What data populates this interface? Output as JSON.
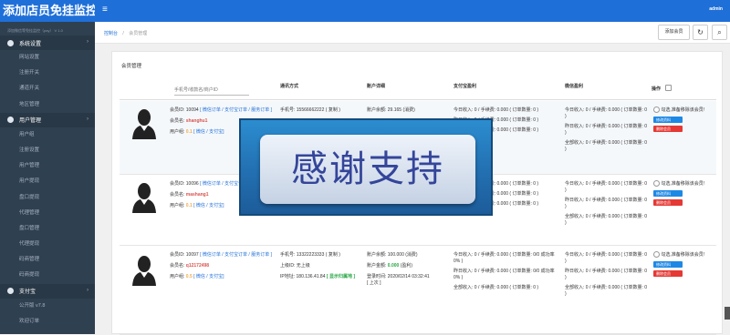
{
  "app": {
    "logo": "添加店员免挂监控",
    "subtitle": "添加微信等免挂监控（pay） V 1.0",
    "user": "admin"
  },
  "sidebar": [
    {
      "type": "section",
      "label": "系统设置",
      "icon": "gear-icon"
    },
    {
      "type": "item",
      "label": "网站设置"
    },
    {
      "type": "item",
      "label": "注册开关"
    },
    {
      "type": "item",
      "label": "通道开关"
    },
    {
      "type": "item",
      "label": "地区管理"
    },
    {
      "type": "section",
      "label": "用户管理",
      "icon": "user-icon"
    },
    {
      "type": "item",
      "label": "用户组"
    },
    {
      "type": "item",
      "label": "注册设置"
    },
    {
      "type": "item",
      "label": "用户管理"
    },
    {
      "type": "item",
      "label": "用户提现"
    },
    {
      "type": "item",
      "label": "盘口提现"
    },
    {
      "type": "item",
      "label": "代理管理"
    },
    {
      "type": "item",
      "label": "盘口管理"
    },
    {
      "type": "item",
      "label": "代理提现"
    },
    {
      "type": "item",
      "label": "码商管理"
    },
    {
      "type": "item",
      "label": "码商提现"
    },
    {
      "type": "section",
      "label": "支付宝",
      "icon": "alipay-icon"
    },
    {
      "type": "item",
      "label": "公开版 v7.8"
    },
    {
      "type": "item",
      "label": "欢迎订单"
    }
  ],
  "breadcrumb": {
    "home": "控制台",
    "sep": "/",
    "current": "会员管理"
  },
  "toolbar": {
    "add_label": "添加会员",
    "refresh_icon": "↻",
    "search_icon": "⌕"
  },
  "panel": {
    "title": "会员管理",
    "search_placeholder": "手机号/收款名/商户ID",
    "headers": {
      "contact": "通讯方式",
      "account": "账户详细",
      "alipay": "支付宝盈利",
      "wechat": "微信盈利",
      "ops": "操作"
    }
  },
  "rows": [
    {
      "id_label": "会员ID:",
      "id": "10094",
      "id_links": "[ 微信订单 / 支付宝订单 / 服务订单 ]",
      "name_label": "会员名:",
      "name": "shanghu1",
      "group_label": "用户组:",
      "group": "0.1",
      "group_links": "[ 微信 / 支付宝]",
      "phone_label": "手机号:",
      "phone": "15566662222",
      "copy": "( 复制 )",
      "balance_label": "账户余额:",
      "balance": "29.165",
      "balance_note": "(消费)",
      "ali_today": "今日收入: 0 / 手续费: 0.000 ( 订单数量: 0 )",
      "ali_yday": "昨日收入: 0 / 手续费: 0.000 ( 订单数量: 0 )",
      "ali_total": "全部收入: 0 / 手续费: 0.000 ( 订单数量: 0 )",
      "wx_today": "今日收入: 0 / 手续费: 0.000 ( 订单数量: 0 )",
      "wx_yday": "昨日收入: 0 / 手续费: 0.000 ( 订单数量: 0 )",
      "wx_total": "全部收入: 0 / 手续费: 0.000 ( 订单数量: 0 )",
      "check_text": "勾选,准备移除该会员!",
      "btn_edit": "修改资料",
      "btn_delete": "删除会员"
    },
    {
      "id_label": "会员ID:",
      "id": "10096",
      "id_links": "[ 微信订单 / 支付宝订单 / 服务订单 ]",
      "name_label": "会员名:",
      "name": "mashang1",
      "group_label": "用户组:",
      "group": "0.1",
      "group_links": "[ 微信 / 支付宝]",
      "phone_label": "手机号:",
      "phone": "",
      "copy": "",
      "balance_label": "账户余额:",
      "balance": "",
      "balance_note": "",
      "ali_today": "今日收入: 0 / 手续费: 0.000 ( 订单数量: 0 )",
      "ali_yday": "昨日收入: 0 / 手续费: 0.000 ( 订单数量: 0 )",
      "ali_total": "全部收入: 0 / 手续费: 0.000 ( 订单数量: 0 )",
      "wx_today": "今日收入: 0 / 手续费: 0.000 ( 订单数量: 0 )",
      "wx_yday": "昨日收入: 0 / 手续费: 0.000 ( 订单数量: 0 )",
      "wx_total": "全部收入: 0 / 手续费: 0.000 ( 订单数量: 0 )",
      "check_text": "勾选,准备移除该会员!",
      "btn_edit": "修改资料",
      "btn_delete": "删除会员"
    },
    {
      "id_label": "会员ID:",
      "id": "10097",
      "id_links": "[ 微信订单 / 支付宝订单 / 服务订单 ]",
      "name_label": "会员名:",
      "name": "q12172498",
      "group_label": "用户组:",
      "group": "0.5",
      "group_links": "[ 微信 / 支付宝]",
      "phone_label": "手机号:",
      "phone": "13322223333",
      "copy": "( 复制 )",
      "superior_label": "上级ID:",
      "superior": "无上级",
      "ip_label": "IP地址:",
      "ip": "180.136.41.84",
      "ip_link": "[ 显示归属地 ]",
      "balance_label": "账户余额:",
      "balance": "100.000",
      "balance_note": "(消费)",
      "deposit_label": "账户金额:",
      "deposit": "0.000",
      "deposit_note": "(盈利)",
      "login_label": "登录时间:",
      "login": "2020/02/14 03:32:41",
      "login_note": "[ 上次 ]",
      "ali_today": "今日收入: 0 / 手续费: 0.000 ( 订单数量: 0/0 成功率 0% )",
      "ali_yday": "昨日收入: 0 / 手续费: 0.000 ( 订单数量: 0/0 成功率 0% )",
      "ali_total": "全部收入: 0 / 手续费: 0.000 ( 订单数量: 0 )",
      "wx_today": "今日收入: 0 / 手续费: 0.000 ( 订单数量: 0 )",
      "wx_yday": "昨日收入: 0 / 手续费: 0.000 ( 订单数量: 0 )",
      "wx_total": "全部收入: 0 / 手续费: 0.000 ( 订单数量: 0 )",
      "check_text": "勾选,准备移除该会员!",
      "btn_edit": "修改资料",
      "btn_delete": "删除会员"
    }
  ],
  "overlay": {
    "text": "感谢支持"
  }
}
